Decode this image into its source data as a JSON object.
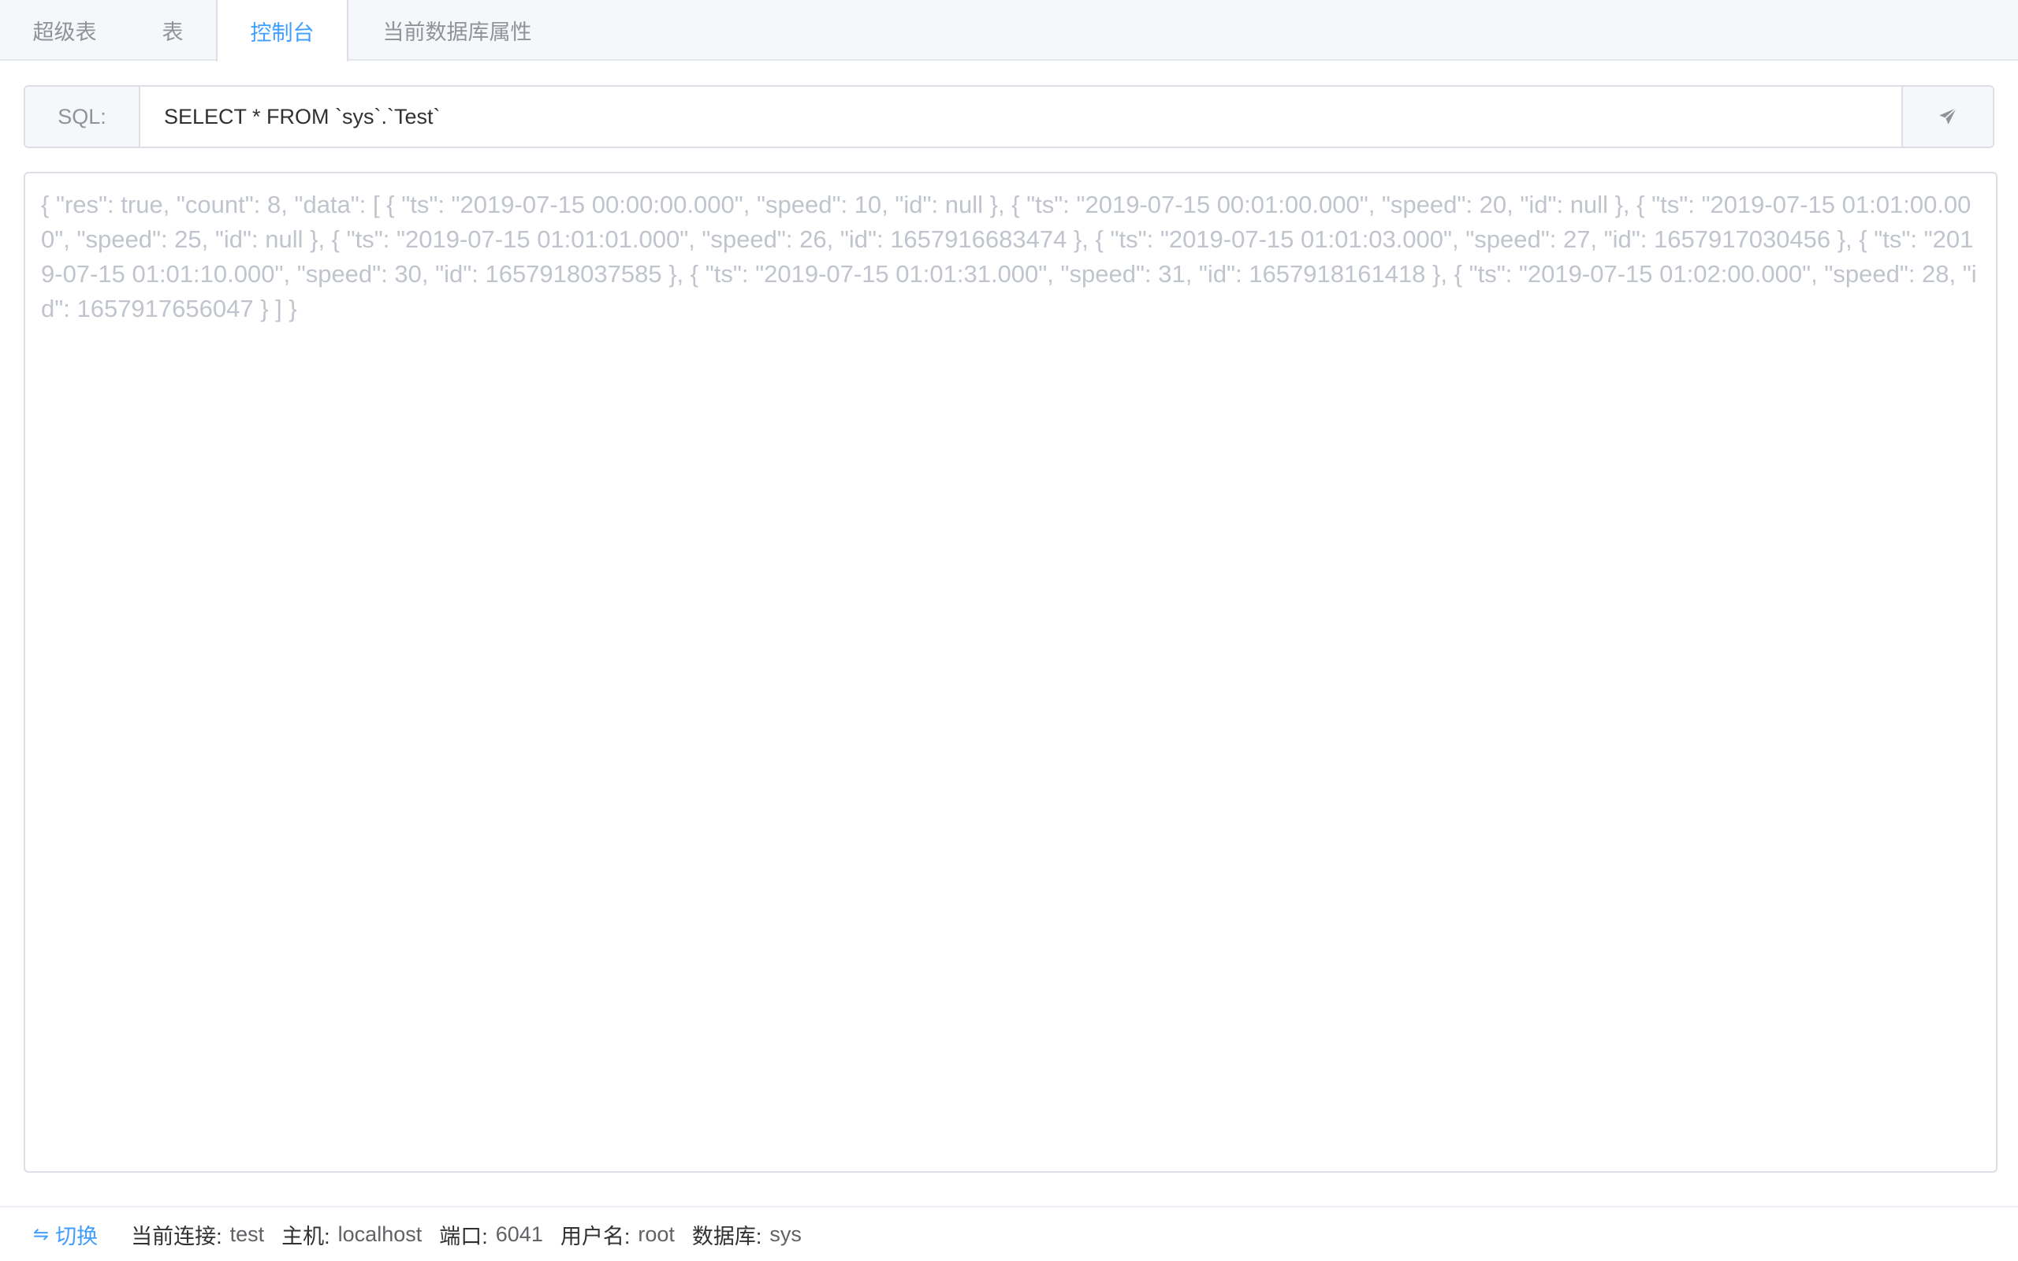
{
  "tabs": [
    {
      "label": "超级表"
    },
    {
      "label": "表"
    },
    {
      "label": "控制台",
      "active": true
    },
    {
      "label": "当前数据库属性"
    }
  ],
  "sql": {
    "prefix": "SQL:",
    "value": "SELECT * FROM `sys`.`Test`",
    "send_icon": "paper-plane-icon"
  },
  "result": {
    "text": "{ \"res\": true, \"count\": 8, \"data\": [ { \"ts\": \"2019-07-15 00:00:00.000\", \"speed\": 10, \"id\": null }, { \"ts\": \"2019-07-15 00:01:00.000\", \"speed\": 20, \"id\": null }, { \"ts\": \"2019-07-15 01:01:00.000\", \"speed\": 25, \"id\": null }, { \"ts\": \"2019-07-15 01:01:01.000\", \"speed\": 26, \"id\": 1657916683474 }, { \"ts\": \"2019-07-15 01:01:03.000\", \"speed\": 27, \"id\": 1657917030456 }, { \"ts\": \"2019-07-15 01:01:10.000\", \"speed\": 30, \"id\": 1657918037585 }, { \"ts\": \"2019-07-15 01:01:31.000\", \"speed\": 31, \"id\": 1657918161418 }, { \"ts\": \"2019-07-15 01:02:00.000\", \"speed\": 28, \"id\": 1657917656047 } ] }"
  },
  "footer": {
    "switch_label": "切换",
    "switch_icon": "swap-icon",
    "connection_key": "当前连接:",
    "connection_val": "test",
    "host_key": "主机:",
    "host_val": "localhost",
    "port_key": "端口:",
    "port_val": "6041",
    "user_key": "用户名:",
    "user_val": "root",
    "db_key": "数据库:",
    "db_val": "sys"
  },
  "colors": {
    "accent": "#409eff",
    "border": "#dcdfe6",
    "muted": "#c0c4cc"
  }
}
